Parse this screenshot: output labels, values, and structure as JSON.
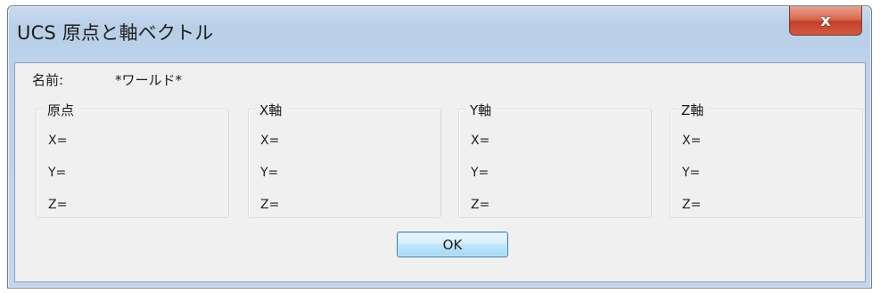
{
  "dialog": {
    "title": "UCS 原点と軸ベクトル",
    "close_label": "x",
    "name_label": "名前:",
    "name_value": "*ワールド*",
    "groups": [
      {
        "title": "原点",
        "fields": [
          "X=",
          "Y=",
          "Z="
        ]
      },
      {
        "title": "X軸",
        "fields": [
          "X=",
          "Y=",
          "Z="
        ]
      },
      {
        "title": "Y軸",
        "fields": [
          "X=",
          "Y=",
          "Z="
        ]
      },
      {
        "title": "Z軸",
        "fields": [
          "X=",
          "Y=",
          "Z="
        ]
      }
    ],
    "ok_label": "OK"
  }
}
